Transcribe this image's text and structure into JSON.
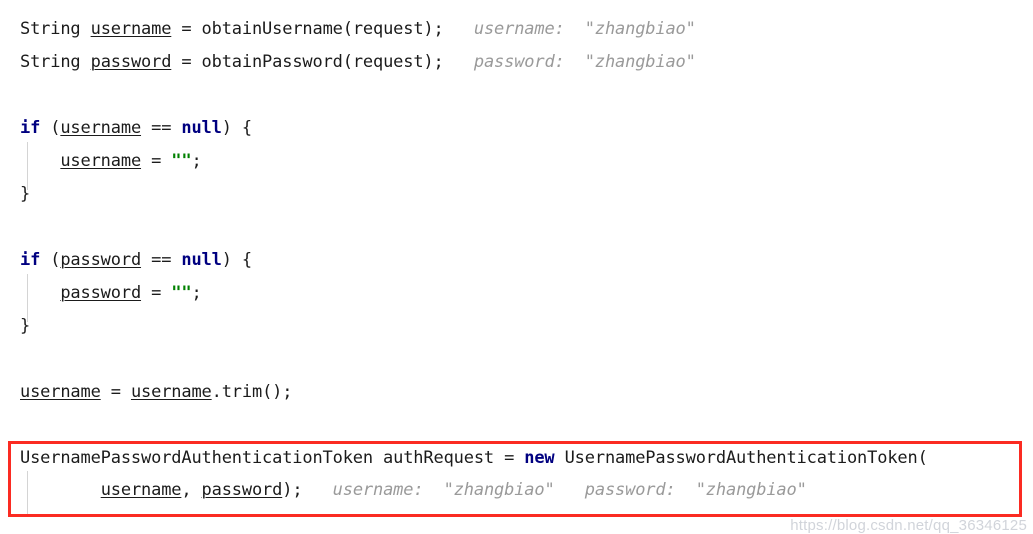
{
  "editor": {
    "language": "java",
    "background_color": "#ffffff",
    "foreground_color": "#1b1b1b",
    "keyword_color": "#000080",
    "string_color": "#008000",
    "hint_color": "#9a9a9a",
    "indent_guide_color": "#d4d4d4",
    "annotation_color": "#fb2b22"
  },
  "lines": [
    {
      "n": 1,
      "text": "String username = obtainUsername(request);",
      "tokens": [
        {
          "t": "String ",
          "k": "plain"
        },
        {
          "t": "username",
          "k": "var"
        },
        {
          "t": " = obtainUsername(request);",
          "k": "plain"
        }
      ],
      "hint": "username:  \"zhangbiao\""
    },
    {
      "n": 2,
      "text": "String password = obtainPassword(request);",
      "tokens": [
        {
          "t": "String ",
          "k": "plain"
        },
        {
          "t": "password",
          "k": "var"
        },
        {
          "t": " = obtainPassword(request);",
          "k": "plain"
        }
      ],
      "hint": "password:  \"zhangbiao\""
    },
    {
      "n": 3,
      "text": "if (username == null) {",
      "tokens": [
        {
          "t": "if",
          "k": "keyword"
        },
        {
          "t": " (",
          "k": "plain"
        },
        {
          "t": "username",
          "k": "var"
        },
        {
          "t": " == ",
          "k": "plain"
        },
        {
          "t": "null",
          "k": "keyword"
        },
        {
          "t": ") {",
          "k": "plain"
        }
      ],
      "hint": ""
    },
    {
      "n": 4,
      "text": "    username = \"\";",
      "tokens": [
        {
          "t": "    ",
          "k": "plain"
        },
        {
          "t": "username",
          "k": "var"
        },
        {
          "t": " = ",
          "k": "plain"
        },
        {
          "t": "\"\"",
          "k": "string"
        },
        {
          "t": ";",
          "k": "plain"
        }
      ],
      "hint": ""
    },
    {
      "n": 5,
      "text": "}",
      "tokens": [
        {
          "t": "}",
          "k": "plain"
        }
      ],
      "hint": ""
    },
    {
      "n": 6,
      "text": "if (password == null) {",
      "tokens": [
        {
          "t": "if",
          "k": "keyword"
        },
        {
          "t": " (",
          "k": "plain"
        },
        {
          "t": "password",
          "k": "var"
        },
        {
          "t": " == ",
          "k": "plain"
        },
        {
          "t": "null",
          "k": "keyword"
        },
        {
          "t": ") {",
          "k": "plain"
        }
      ],
      "hint": ""
    },
    {
      "n": 7,
      "text": "    password = \"\";",
      "tokens": [
        {
          "t": "    ",
          "k": "plain"
        },
        {
          "t": "password",
          "k": "var"
        },
        {
          "t": " = ",
          "k": "plain"
        },
        {
          "t": "\"\"",
          "k": "string"
        },
        {
          "t": ";",
          "k": "plain"
        }
      ],
      "hint": ""
    },
    {
      "n": 8,
      "text": "}",
      "tokens": [
        {
          "t": "}",
          "k": "plain"
        }
      ],
      "hint": ""
    },
    {
      "n": 9,
      "text": "username = username.trim();",
      "tokens": [
        {
          "t": "username",
          "k": "var"
        },
        {
          "t": " = ",
          "k": "plain"
        },
        {
          "t": "username",
          "k": "var"
        },
        {
          "t": ".trim();",
          "k": "plain"
        }
      ],
      "hint": ""
    },
    {
      "n": 10,
      "text": "UsernamePasswordAuthenticationToken authRequest = new UsernamePasswordAuthenticationToken(",
      "tokens": [
        {
          "t": "UsernamePasswordAuthenticationToken authRequest = ",
          "k": "plain"
        },
        {
          "t": "new",
          "k": "keyword"
        },
        {
          "t": " UsernamePasswordAuthenticationToken(",
          "k": "plain"
        }
      ],
      "hint": ""
    },
    {
      "n": 11,
      "text": "        username, password);",
      "tokens": [
        {
          "t": "        ",
          "k": "plain"
        },
        {
          "t": "username",
          "k": "var"
        },
        {
          "t": ", ",
          "k": "plain"
        },
        {
          "t": "password",
          "k": "var"
        },
        {
          "t": ");",
          "k": "plain"
        }
      ],
      "hint": "username:  \"zhangbiao\"   password:  \"zhangbiao\""
    }
  ],
  "watermark": {
    "text": "https://blog.csdn.net/qq_36346125"
  }
}
